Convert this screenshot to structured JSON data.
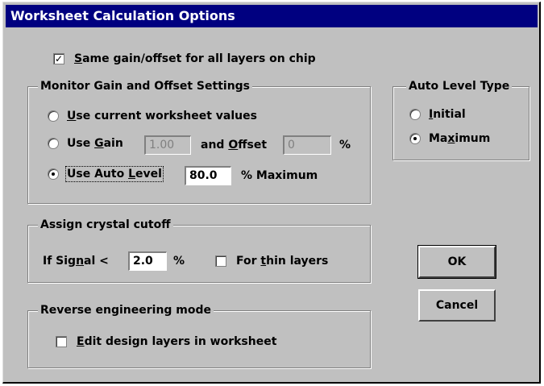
{
  "window": {
    "title": "Worksheet Calculation Options"
  },
  "same_gain": {
    "checked": true,
    "check_glyph": "✓",
    "label_pre": "",
    "label_key": "S",
    "label_post": "ame gain/offset for all layers on chip"
  },
  "monitor_group": {
    "title": "Monitor Gain and Offset Settings",
    "options": [
      {
        "label_key": "U",
        "label_post": "se current worksheet values",
        "selected": false
      },
      {
        "label_pre": "Use ",
        "label_key": "G",
        "label_post": "ain",
        "selected": false
      },
      {
        "label_pre": "Use Auto ",
        "label_key": "L",
        "label_post": "evel",
        "selected": true
      }
    ],
    "gain_value": "1.00",
    "and_label_pre": "and ",
    "offset_key": "O",
    "offset_label_post": "ffset",
    "offset_value": "0",
    "percent_label": "%",
    "auto_level_value": "80.0",
    "auto_level_suffix": "% Maximum"
  },
  "auto_level_type": {
    "title": "Auto Level Type",
    "initial_key": "I",
    "initial_post": "nitial",
    "initial_selected": false,
    "max_pre": "Ma",
    "max_key": "x",
    "max_post": "imum",
    "max_selected": true
  },
  "cutoff_group": {
    "title": "Assign crystal cutoff",
    "signal_pre": "If Sig",
    "signal_key": "n",
    "signal_post": "al <",
    "signal_value": "2.0",
    "percent_label": "%",
    "thin_checked": false,
    "thin_pre": "For ",
    "thin_key": "t",
    "thin_post": "hin layers"
  },
  "reverse_group": {
    "title": "Reverse engineering mode",
    "edit_checked": false,
    "edit_key": "E",
    "edit_post": "dit design layers in worksheet"
  },
  "buttons": {
    "ok": "OK",
    "cancel": "Cancel"
  },
  "colors": {
    "titlebar": "#000080",
    "face": "#c0c0c0"
  }
}
